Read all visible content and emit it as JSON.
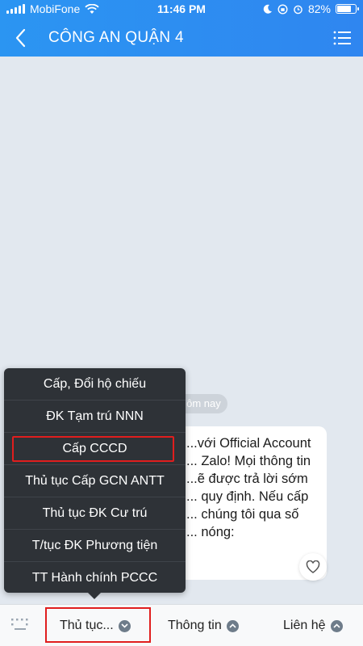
{
  "status_bar": {
    "carrier": "MobiFone",
    "time": "11:46 PM",
    "battery": "82%",
    "battery_level": 0.82
  },
  "header": {
    "title": "CÔNG AN QUẬN 4",
    "back_icon": "chevron-left-icon",
    "menu_icon": "list-menu-icon"
  },
  "chat": {
    "date_label": "...ôm nay",
    "message_text": "...với Official Account\n... Zalo! Mọi thông tin\n...ẽ được trả lời sớm\n... quy định. Nếu cấp\n... chúng tôi qua số\n... nóng:"
  },
  "popup_menu": {
    "items": [
      {
        "label": "Cấp, Đổi hộ chiếu"
      },
      {
        "label": "ĐK Tạm trú NNN"
      },
      {
        "label": "Cấp CCCD"
      },
      {
        "label": "Thủ tục Cấp GCN ANTT"
      },
      {
        "label": "Thủ tục ĐK Cư trú"
      },
      {
        "label": "T/tục ĐK Phương tiện"
      },
      {
        "label": "TT Hành chính PCCC"
      }
    ]
  },
  "bottom_bar": {
    "tabs": [
      {
        "label": "Thủ tục..."
      },
      {
        "label": "Thông tin"
      },
      {
        "label": "Liên hệ"
      }
    ]
  },
  "colors": {
    "header": "#2f8ef2",
    "popup": "#2e3237",
    "highlight": "#e01e1e"
  }
}
